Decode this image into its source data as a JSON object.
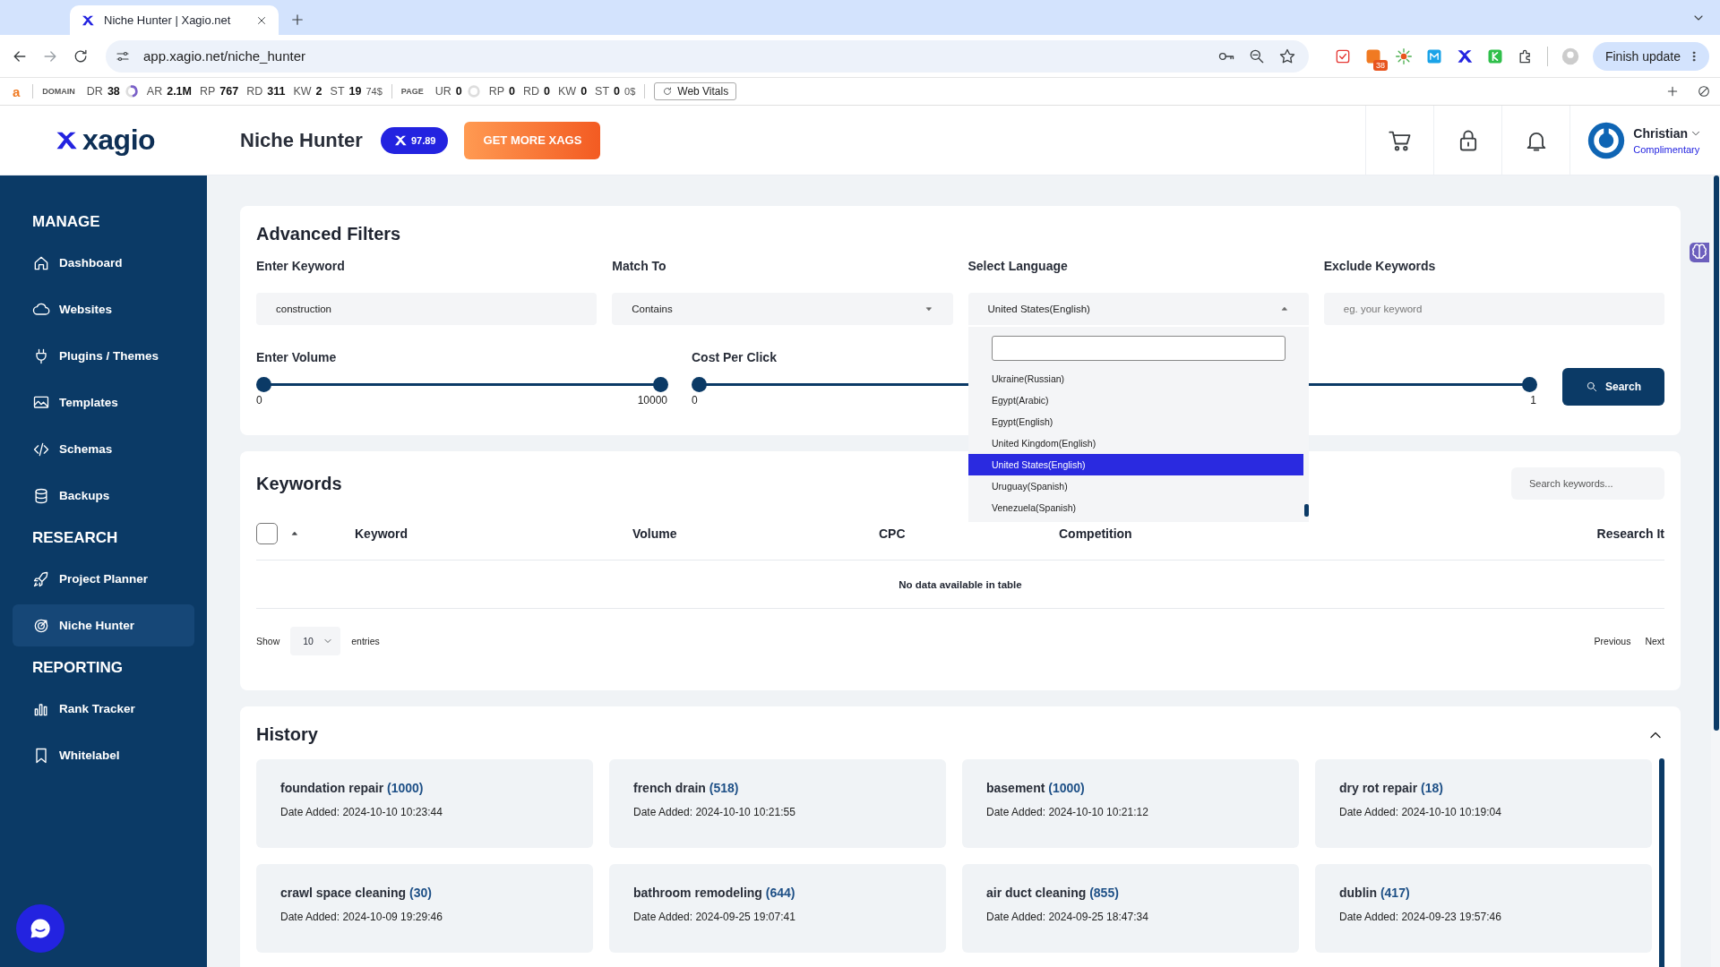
{
  "browser": {
    "tab_title": "Niche Hunter | Xagio.net",
    "url": "app.xagio.net/niche_hunter",
    "extension_badge": "38",
    "finish_update": "Finish update"
  },
  "seo_bar": {
    "logo": "a",
    "domain_label": "DOMAIN",
    "domain_metrics": [
      {
        "label": "DR",
        "value": "38",
        "ring": true
      },
      {
        "label": "AR",
        "value": "2.1M"
      },
      {
        "label": "RP",
        "value": "767"
      },
      {
        "label": "RD",
        "value": "311"
      },
      {
        "label": "KW",
        "value": "2"
      },
      {
        "label": "ST",
        "value": "19",
        "extra": "74$"
      }
    ],
    "page_label": "PAGE",
    "page_metrics": [
      {
        "label": "UR",
        "value": "0",
        "ring": true
      },
      {
        "label": "RP",
        "value": "0"
      },
      {
        "label": "RD",
        "value": "0"
      },
      {
        "label": "KW",
        "value": "0"
      },
      {
        "label": "ST",
        "value": "0",
        "extra": "0$"
      }
    ],
    "web_vitals": "Web Vitals"
  },
  "header": {
    "logo": "xagio",
    "title": "Niche Hunter",
    "score": "97.89",
    "cta": "GET MORE XAGS",
    "user_name": "Christian",
    "user_plan": "Complimentary"
  },
  "sidebar": [
    {
      "heading": "MANAGE",
      "items": [
        {
          "label": "Dashboard",
          "selected": false
        },
        {
          "label": "Websites",
          "selected": false
        },
        {
          "label": "Plugins / Themes",
          "selected": false
        },
        {
          "label": "Templates",
          "selected": false
        },
        {
          "label": "Schemas",
          "selected": false
        },
        {
          "label": "Backups",
          "selected": false
        }
      ]
    },
    {
      "heading": "RESEARCH",
      "items": [
        {
          "label": "Project Planner",
          "selected": false
        },
        {
          "label": "Niche Hunter",
          "selected": true
        }
      ]
    },
    {
      "heading": "REPORTING",
      "items": [
        {
          "label": "Rank Tracker",
          "selected": false
        },
        {
          "label": "Whitelabel",
          "selected": false
        }
      ]
    }
  ],
  "filters": {
    "title": "Advanced Filters",
    "keyword": {
      "label": "Enter Keyword",
      "value": "construction"
    },
    "match": {
      "label": "Match To",
      "value": "Contains"
    },
    "language": {
      "label": "Select Language",
      "value": "United States(English)",
      "expanded": true
    },
    "exclude": {
      "label": "Exclude Keywords",
      "placeholder": "eg. your keyword"
    },
    "volume": {
      "label": "Enter Volume",
      "min": "0",
      "max": "10000",
      "level": 1
    },
    "cpc": {
      "label": "Cost Per Click",
      "min": "0",
      "max": "1",
      "level": 1
    },
    "search_button": "Search",
    "language_options": [
      {
        "label": "Ukraine(Russian)",
        "selected": false
      },
      {
        "label": "Egypt(Arabic)",
        "selected": false
      },
      {
        "label": "Egypt(English)",
        "selected": false
      },
      {
        "label": "United Kingdom(English)",
        "selected": false
      },
      {
        "label": "United States(English)",
        "selected": true
      },
      {
        "label": "Uruguay(Spanish)",
        "selected": false
      },
      {
        "label": "Venezuela(Spanish)",
        "selected": false
      }
    ]
  },
  "keywords": {
    "title": "Keywords",
    "search_placeholder": "Search keywords...",
    "select_all_checked": false,
    "columns": [
      "Keyword",
      "Volume",
      "CPC",
      "Competition",
      "Research It"
    ],
    "empty": "No data available in table",
    "show": "Show",
    "page_size": "10",
    "entries": "entries",
    "previous": "Previous",
    "next": "Next"
  },
  "history": {
    "title": "History",
    "expanded": true,
    "items": [
      {
        "term": "foundation repair",
        "count": "(1000)",
        "date": "Date Added: 2024-10-10 10:23:44"
      },
      {
        "term": "french drain",
        "count": "(518)",
        "date": "Date Added: 2024-10-10 10:21:55"
      },
      {
        "term": "basement",
        "count": "(1000)",
        "date": "Date Added: 2024-10-10 10:21:12"
      },
      {
        "term": "dry rot repair",
        "count": "(18)",
        "date": "Date Added: 2024-10-10 10:19:04"
      },
      {
        "term": "crawl space cleaning",
        "count": "(30)",
        "date": "Date Added: 2024-10-09 19:29:46"
      },
      {
        "term": "bathroom remodeling",
        "count": "(644)",
        "date": "Date Added: 2024-09-25 19:07:41"
      },
      {
        "term": "air duct cleaning",
        "count": "(855)",
        "date": "Date Added: 2024-09-25 18:47:34"
      },
      {
        "term": "dublin",
        "count": "(417)",
        "date": "Date Added: 2024-09-23 19:57:46"
      }
    ]
  }
}
